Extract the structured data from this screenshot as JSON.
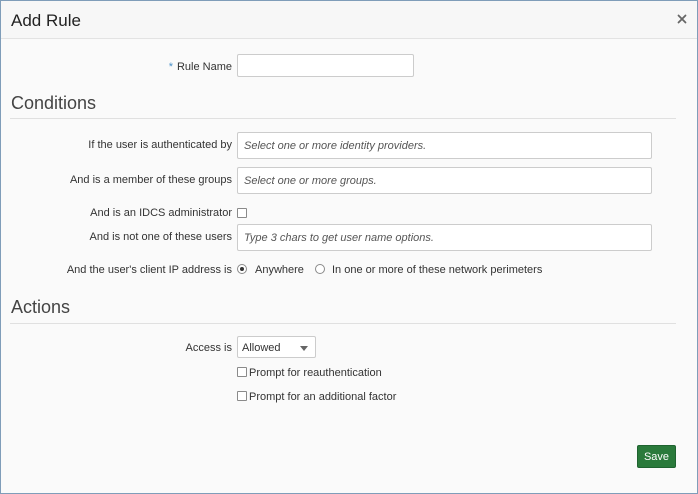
{
  "dialog": {
    "title": "Add Rule",
    "close_icon": "close-icon"
  },
  "rule_name": {
    "label": "Rule Name",
    "required_marker": "*",
    "value": ""
  },
  "conditions": {
    "heading": "Conditions",
    "identity_providers": {
      "label": "If the user is authenticated by",
      "placeholder": "Select one or more identity providers."
    },
    "groups": {
      "label": "And is a member of these groups",
      "placeholder": "Select one or more groups."
    },
    "idcs_admin": {
      "label": "And is an IDCS administrator",
      "checked": false
    },
    "excluded_users": {
      "label": "And is not one of these users",
      "placeholder": "Type 3 chars to get user name options."
    },
    "client_ip": {
      "label": "And the user's client IP address is",
      "options": [
        {
          "label": "Anywhere",
          "selected": true
        },
        {
          "label": "In one or more of these network perimeters",
          "selected": false
        }
      ]
    }
  },
  "actions": {
    "heading": "Actions",
    "access": {
      "label": "Access is",
      "selected": "Allowed"
    },
    "reauth": {
      "label": "Prompt for reauthentication",
      "checked": false
    },
    "additional_factor": {
      "label": "Prompt for an additional factor",
      "checked": false
    }
  },
  "footer": {
    "save_label": "Save"
  },
  "colors": {
    "save_button": "#2a7a3b",
    "required_marker": "#4a90c8"
  }
}
